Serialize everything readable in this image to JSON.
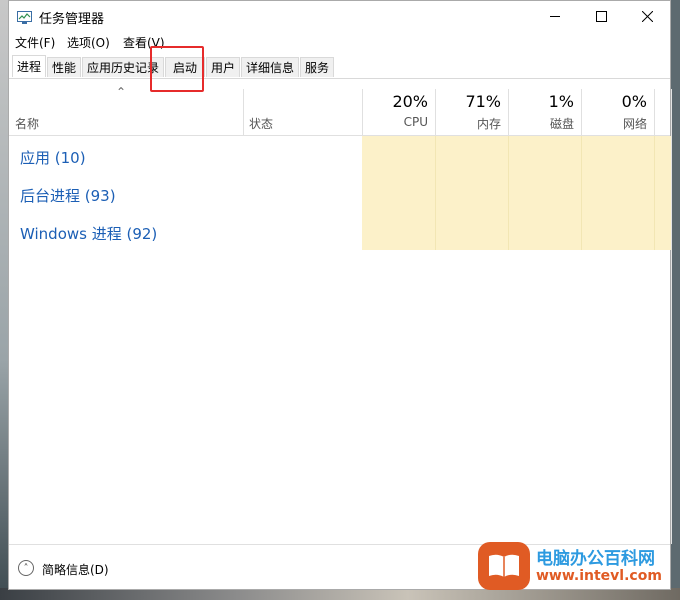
{
  "window": {
    "title": "任务管理器"
  },
  "menu": {
    "file": "文件(F)",
    "options": "选项(O)",
    "view": "查看(V)"
  },
  "tabs": [
    {
      "label": "进程",
      "active": true
    },
    {
      "label": "性能"
    },
    {
      "label": "应用历史记录"
    },
    {
      "label": "启动"
    },
    {
      "label": "用户"
    },
    {
      "label": "详细信息"
    },
    {
      "label": "服务"
    }
  ],
  "columns": {
    "name": "名称",
    "status": "状态",
    "cpu": {
      "percent": "20%",
      "label": "CPU"
    },
    "memory": {
      "percent": "71%",
      "label": "内存"
    },
    "disk": {
      "percent": "1%",
      "label": "磁盘"
    },
    "network": {
      "percent": "0%",
      "label": "网络"
    }
  },
  "groups": [
    {
      "label": "应用 (10)"
    },
    {
      "label": "后台进程 (93)"
    },
    {
      "label": "Windows 进程 (92)"
    }
  ],
  "footer": {
    "fewer_details": "简略信息(D)"
  },
  "watermark": {
    "title": "电脑办公百科网",
    "url": "www.intevl.com"
  },
  "colors": {
    "accent_link": "#1c5fb5",
    "heat": "#fcf1c9",
    "highlight": "#e62b2b"
  }
}
